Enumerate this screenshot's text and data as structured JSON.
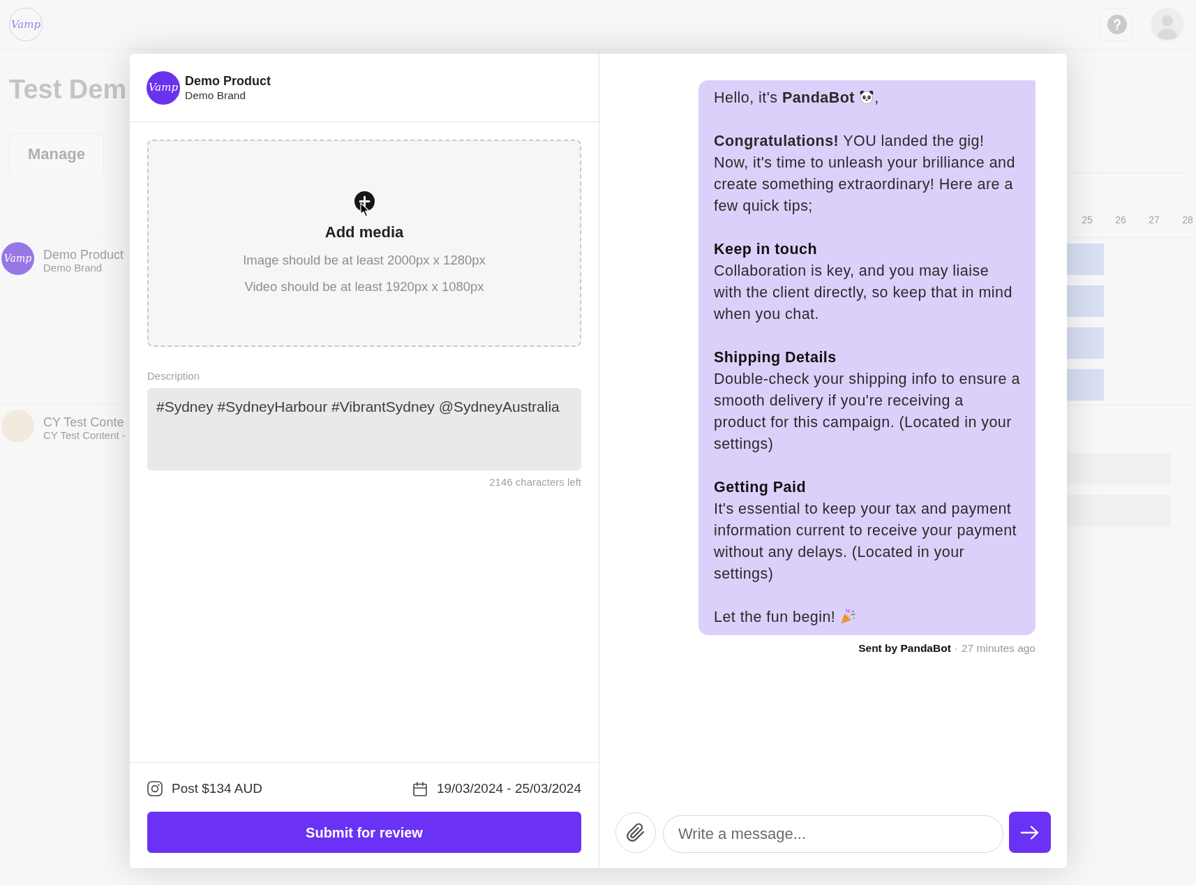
{
  "top_bar": {
    "logo_text": "Vamp"
  },
  "background": {
    "title": "Test Dem",
    "tabs": [
      {
        "label": "Manage",
        "selected": true
      }
    ],
    "rows": [
      {
        "kind": "logo",
        "logo_text": "Vamp",
        "title": "Demo Product",
        "subtitle": "Demo Brand"
      },
      {
        "kind": "photo",
        "title": "CY Test Conte",
        "subtitle": "CY Test Content -"
      }
    ],
    "days": [
      "25",
      "26",
      "27",
      "28"
    ]
  },
  "modal": {
    "product": {
      "logo_text": "Vamp",
      "name": "Demo Product",
      "brand": "Demo Brand"
    },
    "upload": {
      "title": "Add media",
      "hints": [
        "Image should be at least 2000px x 1280px",
        "Video should be at least 1920px x 1080px"
      ]
    },
    "description": {
      "label": "Description",
      "value": "#Sydney #SydneyHarbour #VibrantSydney @SydneyAustralia",
      "counter": "2146 characters left"
    },
    "footer": {
      "post": "Post $134 AUD",
      "dates": "19/03/2024 - 25/03/2024",
      "button": "Submit for review"
    },
    "chat": {
      "message": {
        "paragraphs": [
          {
            "kind": "greeting",
            "text": "Hello, it's **PandaBot**",
            "suffix": ","
          },
          {
            "kind": "text",
            "text": "**Congratulations!** YOU landed the gig!\nNow, it's time to unleash your brilliance and create something extraordinary! Here are a few quick tips;"
          },
          {
            "kind": "tip",
            "heading": "Keep in touch",
            "text": "Collaboration is key, and you may liaise with the client directly, so keep that in mind when you chat."
          },
          {
            "kind": "tip",
            "heading": "Shipping Details",
            "text": "Double-check your shipping info to ensure a smooth delivery if you're receiving a product for this campaign. (Located in your settings)"
          },
          {
            "kind": "tip",
            "heading": "Getting Paid",
            "text": "It's essential to keep your tax and payment information current to receive your payment without any delays. (Located in your settings)"
          },
          {
            "kind": "closing",
            "text": "Let the fun begin!"
          }
        ],
        "sender": "Sent by PandaBot",
        "separator": "·",
        "time": "27 minutes ago"
      },
      "input": {
        "placeholder": "Write a message..."
      }
    }
  }
}
